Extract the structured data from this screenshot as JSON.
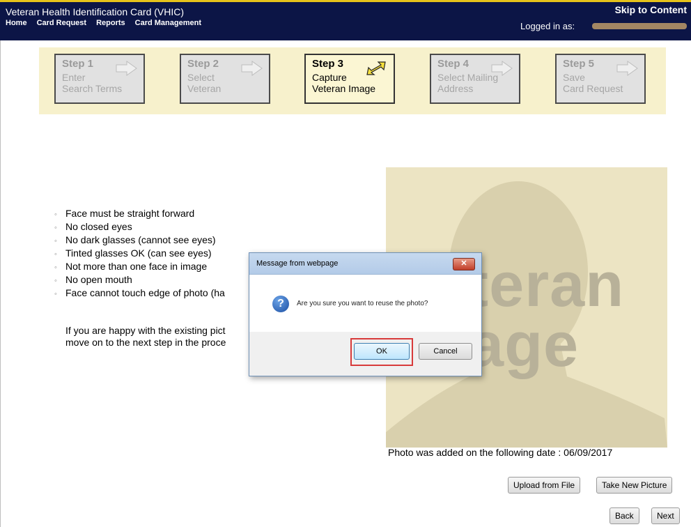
{
  "header": {
    "title": "Veteran Health Identification Card (VHIC)",
    "nav": [
      "Home",
      "Card Request",
      "Reports",
      "Card Management"
    ],
    "skip_link": "Skip to Content",
    "logged_in_label": "Logged in as:"
  },
  "steps": [
    {
      "num": "Step 1",
      "line1": "Enter",
      "line2": "Search Terms",
      "active": false
    },
    {
      "num": "Step 2",
      "line1": "Select",
      "line2": "Veteran",
      "active": false
    },
    {
      "num": "Step 3",
      "line1": "Capture",
      "line2": "Veteran Image",
      "active": true
    },
    {
      "num": "Step 4",
      "line1": "Select Mailing",
      "line2": "Address",
      "active": false
    },
    {
      "num": "Step 5",
      "line1": "Save",
      "line2": "Card Request",
      "active": false
    }
  ],
  "rules": [
    "Face must be straight forward",
    "No closed eyes",
    "No dark glasses (cannot see eyes)",
    "Tinted glasses OK (can see eyes)",
    "Not more than one face in image",
    "No open mouth",
    "Face cannot touch edge of photo (ha"
  ],
  "happy_text_line1": "If you are happy with the existing pict",
  "happy_text_line2": "move on to the next step in the proce",
  "photo": {
    "placeholder_word1": "Veteran",
    "placeholder_word2": "Image",
    "added_text": "Photo was added on the following date : 06/09/2017"
  },
  "buttons": {
    "upload": "Upload from File",
    "take_new": "Take New Picture",
    "back": "Back",
    "next": "Next"
  },
  "dialog": {
    "title": "Message from webpage",
    "close_glyph": "✕",
    "question_glyph": "?",
    "message": "Are you sure you want to reuse the photo?",
    "ok": "OK",
    "cancel": "Cancel"
  }
}
